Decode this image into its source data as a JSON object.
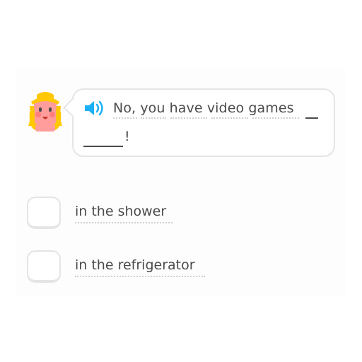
{
  "challenge": {
    "sentence_text": "No, you have video games",
    "sentence_end": "!",
    "audio_icon": "speaker-icon",
    "character_icon": "character-avatar",
    "colors": {
      "text": "#4b4b4b",
      "border": "#e5e5e5",
      "audio_icon": "#1cb0f6",
      "character_hair": "#ffc800",
      "character_skin": "#ff9c9c"
    }
  },
  "options": [
    {
      "label": "in the shower"
    },
    {
      "label": "in the refrigerator"
    }
  ]
}
